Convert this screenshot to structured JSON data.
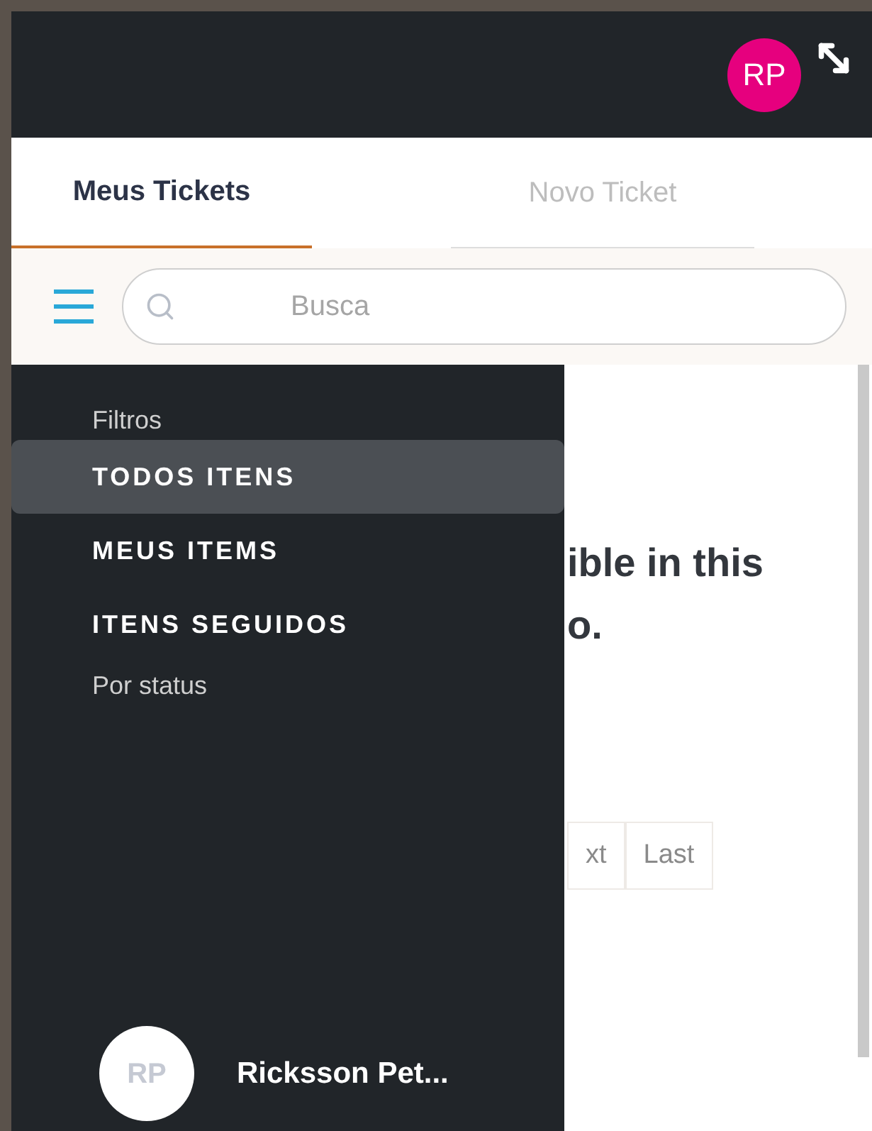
{
  "top_bar": {
    "avatar_initials": "RP"
  },
  "tabs": [
    {
      "label": "Meus Tickets",
      "selected": true
    },
    {
      "label": "Novo Ticket",
      "selected": false
    }
  ],
  "search": {
    "placeholder": "Busca"
  },
  "content": {
    "message_lines": [
      "ible in this",
      "o."
    ],
    "pagination": [
      "xt",
      "Last"
    ]
  },
  "drawer": {
    "heading": "Filtros",
    "items": [
      {
        "label": "TODOS ITENS",
        "selected": true
      },
      {
        "label": "MEUS ITEMS",
        "selected": false
      },
      {
        "label": "ITENS SEGUIDOS",
        "selected": false
      }
    ],
    "subheading": "Por status",
    "user": {
      "initials": "RP",
      "name": "Ricksson Pet..."
    }
  }
}
